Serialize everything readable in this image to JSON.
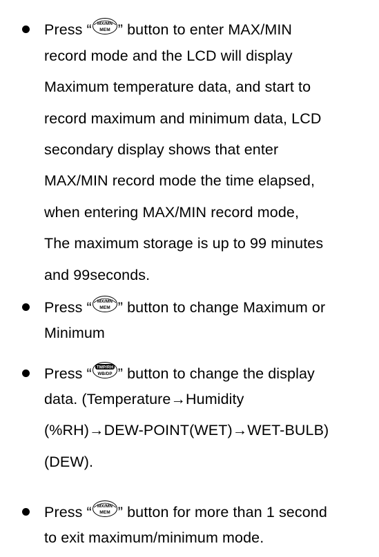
{
  "bullets": [
    {
      "lines": [
        {
          "pre": "Press “",
          "icon": "max-min-mem-button-icon",
          "post": "” button to enter MAX/MIN"
        },
        {
          "text": "record mode and the LCD will display"
        },
        {
          "text": "Maximum temperature data, and start to"
        },
        {
          "text": "record maximum and minimum data, LCD"
        },
        {
          "text": "secondary display shows that enter"
        },
        {
          "text": "MAX/MIN record mode the time elapsed,"
        },
        {
          "text": "when entering MAX/MIN record mode,"
        },
        {
          "text": "The maximum storage is up to 99 minutes"
        },
        {
          "text": "and 99seconds."
        }
      ]
    },
    {
      "lines": [
        {
          "pre": "Press “",
          "icon": "max-min-mem-button-icon",
          "post": "” button to change Maximum or"
        },
        {
          "text": "Minimum"
        }
      ]
    },
    {
      "lines": [
        {
          "pre": "Press “",
          "icon": "tmp-rh-wb-dp-button-icon",
          "post": "” button to change the display"
        },
        {
          "text": "data. (Temperature→Humidity"
        },
        {
          "text": "(%RH)→DEW-POINT(WET)→WET-BULB)"
        },
        {
          "text": "(DEW)."
        }
      ]
    },
    {
      "lines": [
        {
          "pre": "Press “",
          "icon": "max-min-mem-button-icon",
          "post": "” button for more than 1 second"
        },
        {
          "text": "to exit maximum/minimum mode."
        }
      ]
    }
  ],
  "icons": {
    "max_min_mem": {
      "top": "MX/MN",
      "bottom": "MEM"
    },
    "tmp_rh_wb_dp": {
      "top": "TMP/RH",
      "bottom": "WB/DP"
    }
  }
}
